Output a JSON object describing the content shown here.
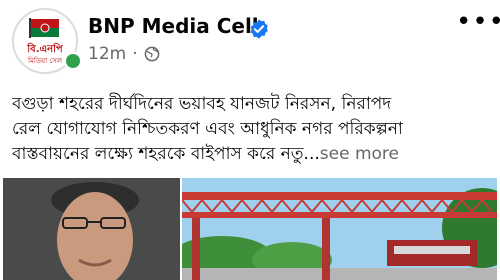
{
  "header": {
    "page_name": "BNP Media Cell",
    "timestamp": "12m",
    "separator": "·",
    "logo_line1": "বি.এনপি",
    "logo_line2": "মিডিয়া সেল",
    "verified_icon": "verified-badge-icon",
    "privacy_icon": "globe-icon",
    "more_icon": "more-options-icon",
    "brand_color": "#1877f2",
    "online_color": "#31a24c"
  },
  "post": {
    "line1": "বগুড়া শহরের দীর্ঘদিনের ভয়াবহ যানজট নিরসন, নিরাপদ",
    "line2": "রেল যোগাযোগ নিশ্চিতকরণ এবং আধুনিক নগর পরিকল্পনা",
    "line3": "বাস্তবায়নের লক্ষ্যে শহরকে বাইপাস করে নতু...",
    "see_more": "see more"
  },
  "media": {
    "left_image": "portrait-photo",
    "right_image": "railway-footbridge-photo"
  }
}
